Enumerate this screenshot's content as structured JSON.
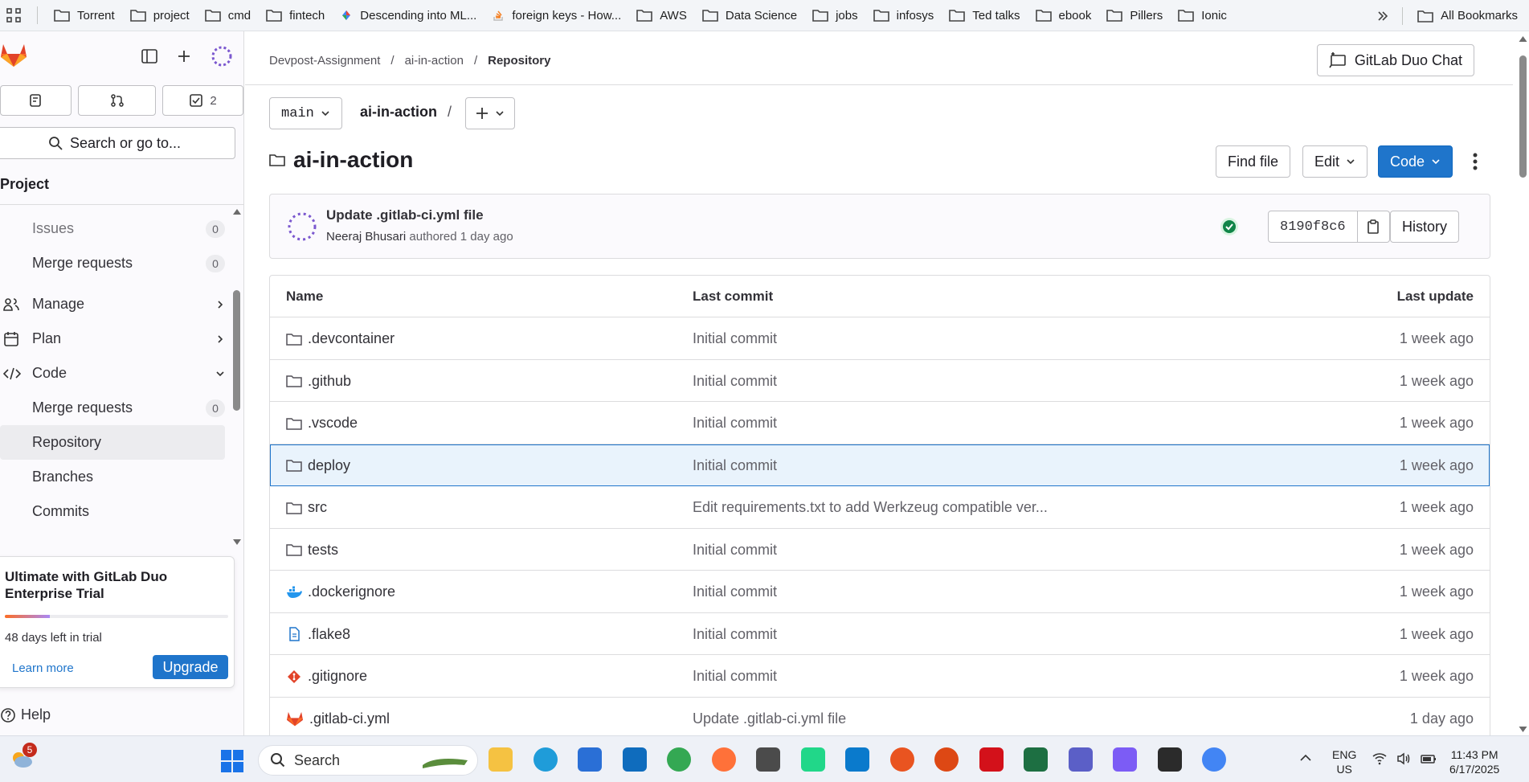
{
  "bookmarks": {
    "items": [
      "Torrent",
      "project",
      "cmd",
      "fintech",
      "Descending into ML...",
      "foreign keys - How...",
      "AWS",
      "Data Science",
      "jobs",
      "infosys",
      "Ted talks",
      "ebook",
      "Pillers",
      "Ionic"
    ],
    "all_label": "All Bookmarks"
  },
  "sidebar": {
    "counts": {
      "merge_requests_badge": "",
      "todos": "2"
    },
    "search_label": "Search or go to...",
    "section_title": "Project",
    "items": [
      {
        "label": "Issues",
        "badge": "0"
      },
      {
        "label": "Merge requests",
        "badge": "0"
      },
      {
        "label": "Manage"
      },
      {
        "label": "Plan"
      },
      {
        "label": "Code"
      },
      {
        "label": "Merge requests",
        "badge": "0"
      },
      {
        "label": "Repository"
      },
      {
        "label": "Branches"
      },
      {
        "label": "Commits"
      }
    ],
    "trial": {
      "title": "Ultimate with GitLab Duo Enterprise Trial",
      "days_left": "48 days left in trial",
      "progress": 0.2,
      "learn_more": "Learn more",
      "upgrade": "Upgrade"
    },
    "help": "Help"
  },
  "header": {
    "breadcrumbs": [
      "Devpost-Assignment",
      "ai-in-action",
      "Repository"
    ],
    "duo_chat": "GitLab Duo Chat"
  },
  "repo": {
    "branch": "main",
    "path": "ai-in-action",
    "title": "ai-in-action",
    "find_file": "Find file",
    "edit": "Edit",
    "code": "Code"
  },
  "commit": {
    "message": "Update .gitlab-ci.yml file",
    "author": "Neeraj Bhusari",
    "authored": "authored 1 day ago",
    "sha": "8190f8c6",
    "history": "History"
  },
  "files": {
    "headers": {
      "name": "Name",
      "last_commit": "Last commit",
      "last_update": "Last update"
    },
    "rows": [
      {
        "name": ".devcontainer",
        "type": "folder",
        "commit": "Initial commit",
        "updated": "1 week ago"
      },
      {
        "name": ".github",
        "type": "folder",
        "commit": "Initial commit",
        "updated": "1 week ago"
      },
      {
        "name": ".vscode",
        "type": "folder",
        "commit": "Initial commit",
        "updated": "1 week ago"
      },
      {
        "name": "deploy",
        "type": "folder",
        "commit": "Initial commit",
        "updated": "1 week ago"
      },
      {
        "name": "src",
        "type": "folder",
        "commit": "Edit requirements.txt to add Werkzeug compatible ver...",
        "updated": "1 week ago"
      },
      {
        "name": "tests",
        "type": "folder",
        "commit": "Initial commit",
        "updated": "1 week ago"
      },
      {
        "name": ".dockerignore",
        "type": "docker",
        "commit": "Initial commit",
        "updated": "1 week ago"
      },
      {
        "name": ".flake8",
        "type": "file",
        "commit": "Initial commit",
        "updated": "1 week ago"
      },
      {
        "name": ".gitignore",
        "type": "git",
        "commit": "Initial commit",
        "updated": "1 week ago"
      },
      {
        "name": ".gitlab-ci.yml",
        "type": "gitlab",
        "commit": "Update .gitlab-ci.yml file",
        "updated": "1 day ago"
      }
    ]
  },
  "taskbar": {
    "search": "Search",
    "weather_badge": "5",
    "lang": "ENG",
    "region": "US",
    "time": "11:43 PM",
    "date": "6/17/2025"
  },
  "colors": {
    "accent": "#1f75cb",
    "selected_row": "#e9f3fc"
  }
}
